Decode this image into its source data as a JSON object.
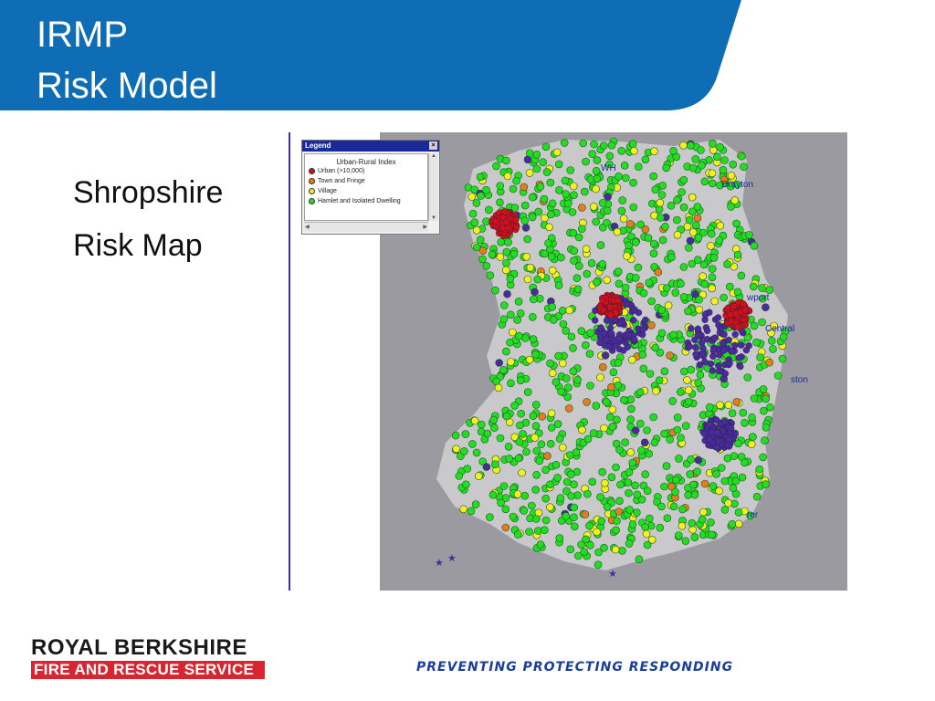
{
  "slide": {
    "title_line1": "IRMP",
    "title_line2": "Risk Model",
    "body_lines": [
      "Shropshire",
      "Risk Map"
    ]
  },
  "map": {
    "place_labels": [
      "WH",
      "Drayton",
      "wport",
      "Central",
      "ston",
      "rer"
    ],
    "legend": {
      "window_title": "Legend",
      "heading": "Urban-Rural Index",
      "items": [
        {
          "label": "Urban (>10,000)",
          "color": "#d01020"
        },
        {
          "label": "Town and Fringe",
          "color": "#e87a20"
        },
        {
          "label": "Village",
          "color": "#f4f020"
        },
        {
          "label": "Hamlet and Isolated Dwelling",
          "color": "#22dd22"
        }
      ],
      "station_marker_color": "#4a2aa0"
    }
  },
  "footer": {
    "logo_line1": "ROYAL BERKSHIRE",
    "logo_line2": "FIRE AND RESCUE SERVICE",
    "tagline": "PREVENTING PROTECTING RESPONDING"
  },
  "colors": {
    "banner": "#0f6db5",
    "map_background": "#9a9aa0",
    "urban": "#d01020",
    "town": "#e87a20",
    "village": "#f4f020",
    "hamlet": "#22dd22",
    "station": "#4a2aa0",
    "tagline": "#1a3e9c",
    "logo_red": "#d7262f"
  }
}
